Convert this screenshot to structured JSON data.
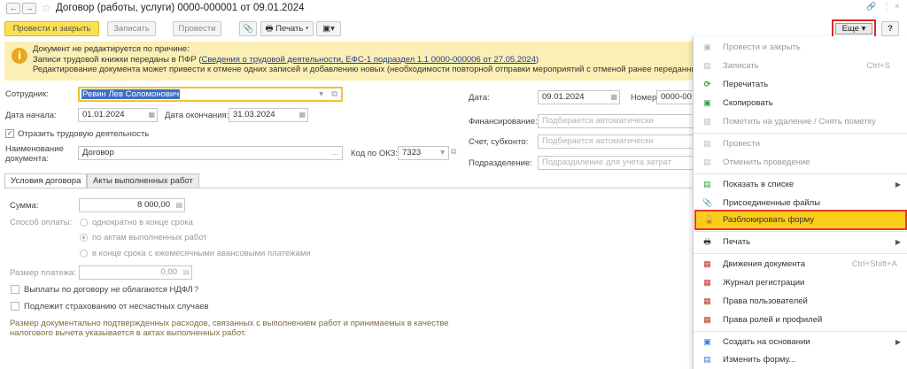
{
  "window": {
    "title": "Договор (работы, услуги) 0000-000001 от 09.01.2024"
  },
  "toolbar": {
    "post_close": "Провести и закрыть",
    "save": "Записать",
    "post": "Провести",
    "print": "Печать",
    "more": "Еще",
    "help": "?"
  },
  "banner": {
    "line1": "Документ не редактируется по причине:",
    "line2_prefix": "Записи трудовой книжки переданы в ПФР (",
    "line2_link": "Сведения о трудовой деятельности, ЕФС-1 подраздел 1.1 0000-000006 от 27.05.2024",
    "line2_suffix": ")",
    "line3": "Редактирование документа может привести к отмене одних записей и добавлению новых (необходимости повторной отправки мероприятий с отменой ранее переданных)."
  },
  "form": {
    "employee_label": "Сотрудник:",
    "employee_value": "Ревин Лев Соломонович",
    "start_label": "Дата начала:",
    "start_value": "01.01.2024",
    "end_label": "Дата окончания:",
    "end_value": "31.03.2024",
    "reflect_label": "Отразить трудовую деятельность",
    "docname_label_1": "Наименование",
    "docname_label_2": "документа:",
    "docname_value": "Договор",
    "okz_label": "Код по ОКЗ:",
    "okz_value": "7323",
    "date_label": "Дата:",
    "date_value": "09.01.2024",
    "number_label": "Номер:",
    "number_value": "0000-00",
    "financing_label": "Финансирование:",
    "financing_placeholder": "Подбирается автоматически",
    "account_label": "Счет, субконто:",
    "account_placeholder": "Подбирается автоматически",
    "division_label": "Подразделение:",
    "division_placeholder": "Подразделение для учета затрат"
  },
  "tabs": {
    "terms": "Условия договора",
    "acts": "Акты выполненных работ"
  },
  "terms": {
    "sum_label": "Сумма:",
    "sum_value": "8 000,00",
    "payment_label": "Способ оплаты:",
    "opt1": "однократно в конце срока",
    "opt2": "по актам выполненных работ",
    "opt3": "в конце срока с ежемесячными авансовыми платежами",
    "payment_size_label": "Размер платежа:",
    "payment_size_value": "0,00",
    "ndfl_label": "Выплаты по договору не облагаются НДФЛ",
    "ndfl_help": "?",
    "insurance_label": "Подлежит страхованию от несчастных случаев",
    "note_line1": "Размер документально подтвержденных расходов, связанных с выполнением работ и принимаемых в качестве",
    "note_line2": "налогового вычета указывается в актах выполненных работ."
  },
  "menu": {
    "items": [
      {
        "label": "Провести и закрыть",
        "shortcut": ""
      },
      {
        "label": "Записать",
        "shortcut": "Ctrl+S"
      },
      {
        "label": "Перечитать",
        "shortcut": ""
      },
      {
        "label": "Скопировать",
        "shortcut": ""
      },
      {
        "label": "Пометить на удаление / Снять пометку",
        "shortcut": ""
      },
      {
        "label": "Провести",
        "shortcut": ""
      },
      {
        "label": "Отменить проведение",
        "shortcut": ""
      },
      {
        "label": "Показать в списке",
        "shortcut": ""
      },
      {
        "label": "Присоединенные файлы",
        "shortcut": ""
      },
      {
        "label": "Разблокировать форму",
        "shortcut": ""
      },
      {
        "label": "Печать",
        "shortcut": ""
      },
      {
        "label": "Движения документа",
        "shortcut": "Ctrl+Shift+A"
      },
      {
        "label": "Журнал регистрации",
        "shortcut": ""
      },
      {
        "label": "Права пользователей",
        "shortcut": ""
      },
      {
        "label": "Права ролей и профилей",
        "shortcut": ""
      },
      {
        "label": "Создать на основании",
        "shortcut": ""
      },
      {
        "label": "Изменить форму...",
        "shortcut": ""
      }
    ]
  },
  "colors": {
    "accent": "#fbe054",
    "highlight": "#f9cd1a",
    "alert_border": "#e0262a",
    "banner_bg": "#fbefb5"
  }
}
